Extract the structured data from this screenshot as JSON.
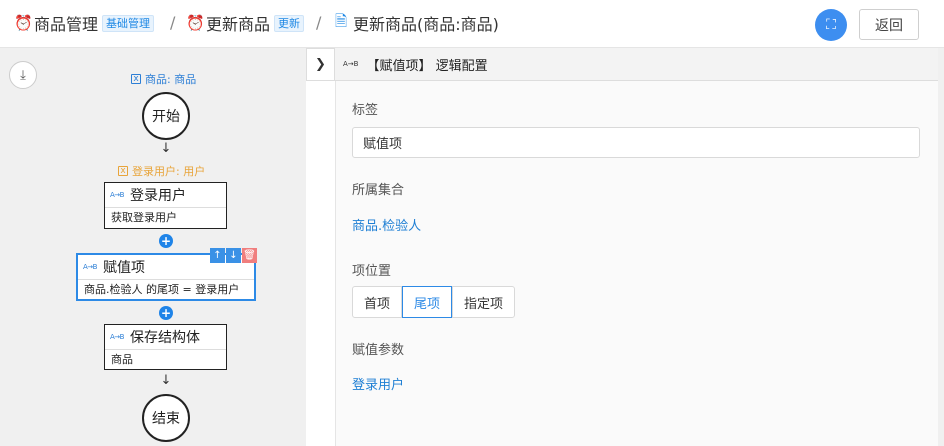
{
  "breadcrumb": [
    {
      "label": "商品管理",
      "tag": "基础管理"
    },
    {
      "label": "更新商品",
      "tag": "更新"
    },
    {
      "label": "更新商品(商品:商品)"
    }
  ],
  "header": {
    "back_label": "返回"
  },
  "canvas": {
    "input_var": "商品: 商品",
    "start_label": "开始",
    "user_var": "登录用户: 用户",
    "nodes": [
      {
        "icon": "A→B",
        "title": "登录用户",
        "sub": "获取登录用户"
      },
      {
        "icon": "A→B",
        "title": "赋值项",
        "sub": "商品.检验人 的尾项 = 登录用户"
      },
      {
        "icon": "A→B",
        "title": "保存结构体",
        "sub": "商品"
      }
    ],
    "end_label": "结束"
  },
  "panel": {
    "icon": "A→B",
    "title": "【赋值项】 逻辑配置",
    "label_field": {
      "label": "标签",
      "value": "赋值项"
    },
    "collection_field": {
      "label": "所属集合",
      "value": "商品.检验人"
    },
    "position_field": {
      "label": "项位置",
      "options": [
        "首项",
        "尾项",
        "指定项"
      ],
      "selected": "尾项"
    },
    "param_field": {
      "label": "赋值参数",
      "value": "登录用户"
    }
  },
  "colors": {
    "accent": "#2d8ae6",
    "var_orange": "#e8a43a",
    "delete_red": "#f07e7e"
  }
}
